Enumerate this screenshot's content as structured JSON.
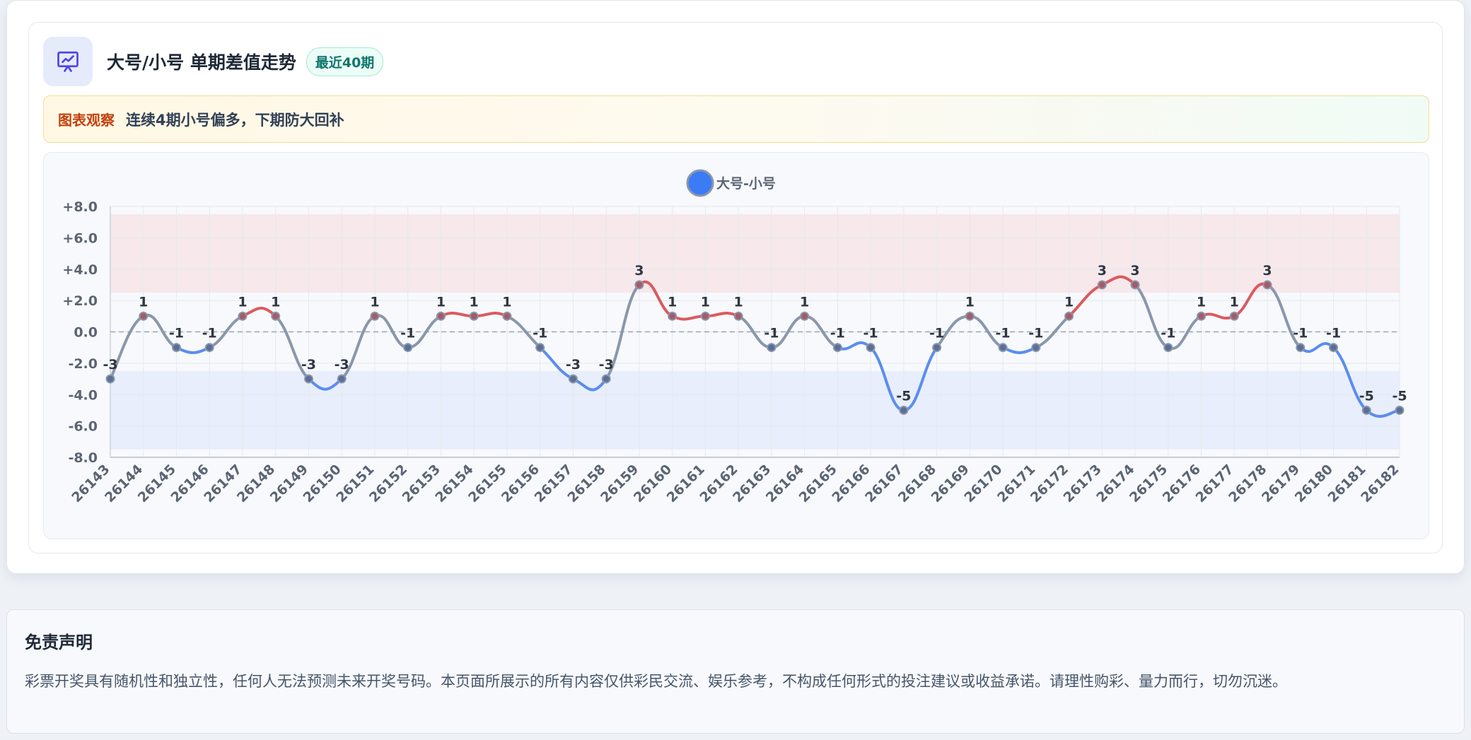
{
  "header": {
    "icon": "presentation-chart-icon",
    "title": "大号/小号 单期差值走势",
    "badge": "最近40期"
  },
  "insight": {
    "tag": "图表观察",
    "text": "连续4期小号偏多，下期防大回补"
  },
  "chart_data": {
    "type": "line",
    "title": "",
    "xlabel": "",
    "ylabel": "",
    "legend": {
      "position": "top-center",
      "entries": [
        "大号-小号"
      ]
    },
    "ylim": [
      -8,
      8
    ],
    "yticks": [
      8,
      6,
      4,
      2,
      0,
      -2,
      -4,
      -6,
      -8
    ],
    "ytick_labels": [
      "+8.0",
      "+6.0",
      "+4.0",
      "+2.0",
      "0.0",
      "-2.0",
      "-4.0",
      "-6.0",
      "-8.0"
    ],
    "x_label_rotation": -45,
    "grid": true,
    "bands": [
      {
        "from": 2.5,
        "to": 7.5,
        "color": "#f6e8eb"
      },
      {
        "from": -7.5,
        "to": -2.5,
        "color": "#e8eefb"
      }
    ],
    "reference_line": 0,
    "categories": [
      "26143",
      "26144",
      "26145",
      "26146",
      "26147",
      "26148",
      "26149",
      "26150",
      "26151",
      "26152",
      "26153",
      "26154",
      "26155",
      "26156",
      "26157",
      "26158",
      "26159",
      "26160",
      "26161",
      "26162",
      "26163",
      "26164",
      "26165",
      "26166",
      "26167",
      "26168",
      "26169",
      "26170",
      "26171",
      "26172",
      "26173",
      "26174",
      "26175",
      "26176",
      "26177",
      "26178",
      "26179",
      "26180",
      "26181",
      "26182"
    ],
    "series": [
      {
        "name": "大号-小号",
        "values": [
          -3,
          1,
          -1,
          -1,
          1,
          1,
          -3,
          -3,
          1,
          -1,
          1,
          1,
          1,
          -1,
          -3,
          -3,
          3,
          1,
          1,
          1,
          -1,
          1,
          -1,
          -1,
          -5,
          -1,
          1,
          -1,
          -1,
          1,
          3,
          3,
          -1,
          1,
          1,
          3,
          -1,
          -1,
          -5,
          -5
        ],
        "color": "#8a97ab",
        "up_color": "#dc5a5e",
        "down_color": "#5b8def",
        "legend_color": "#3b7bf6"
      }
    ]
  },
  "disclaimer": {
    "title": "免责声明",
    "text": "彩票开奖具有随机性和独立性，任何人无法预测未来开奖号码。本页面所展示的所有内容仅供彩民交流、娱乐参考，不构成任何形式的投注建议或收益承诺。请理性购彩、量力而行，切勿沉迷。"
  }
}
